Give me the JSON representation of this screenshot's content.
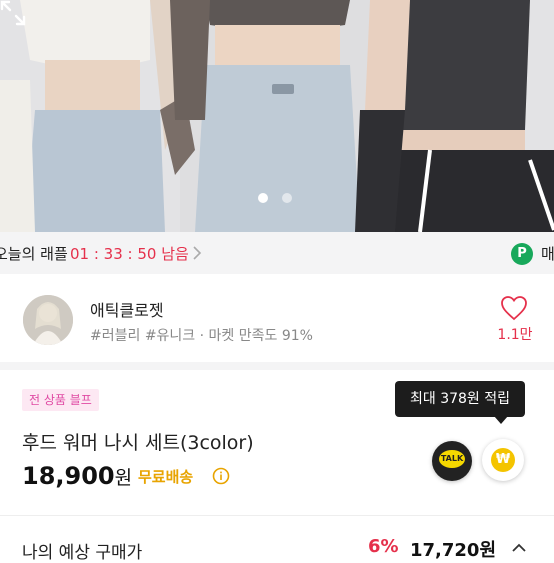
{
  "carousel": {
    "page_count": 2,
    "current_page": 1
  },
  "raffle": {
    "label": "오늘의 래플",
    "time_left": "01 : 33 : 50 남음",
    "point_badge": "P",
    "point_text": "매"
  },
  "shop": {
    "name": "애틱클로젯",
    "meta": "#러블리 #유니크 · 마켓 만족도 91%",
    "like_count": "1.1만"
  },
  "product": {
    "promo_badge": "전 상품 블프",
    "title": "후드 워머 나시 세트(3color)",
    "price": "18,900",
    "price_unit": "원",
    "shipping": "무료배송",
    "tooltip": "최대 378원 적립",
    "talk_label": "TALK",
    "pay_symbol": "₩"
  },
  "bottom": {
    "label": "나의 예상 구매가",
    "discount": "6%",
    "price": "17,720원"
  },
  "colors": {
    "accent_red": "#e5304b",
    "promo_pink": "#e04aa4",
    "shipping_yellow": "#e8a400",
    "point_green": "#18a85b"
  }
}
